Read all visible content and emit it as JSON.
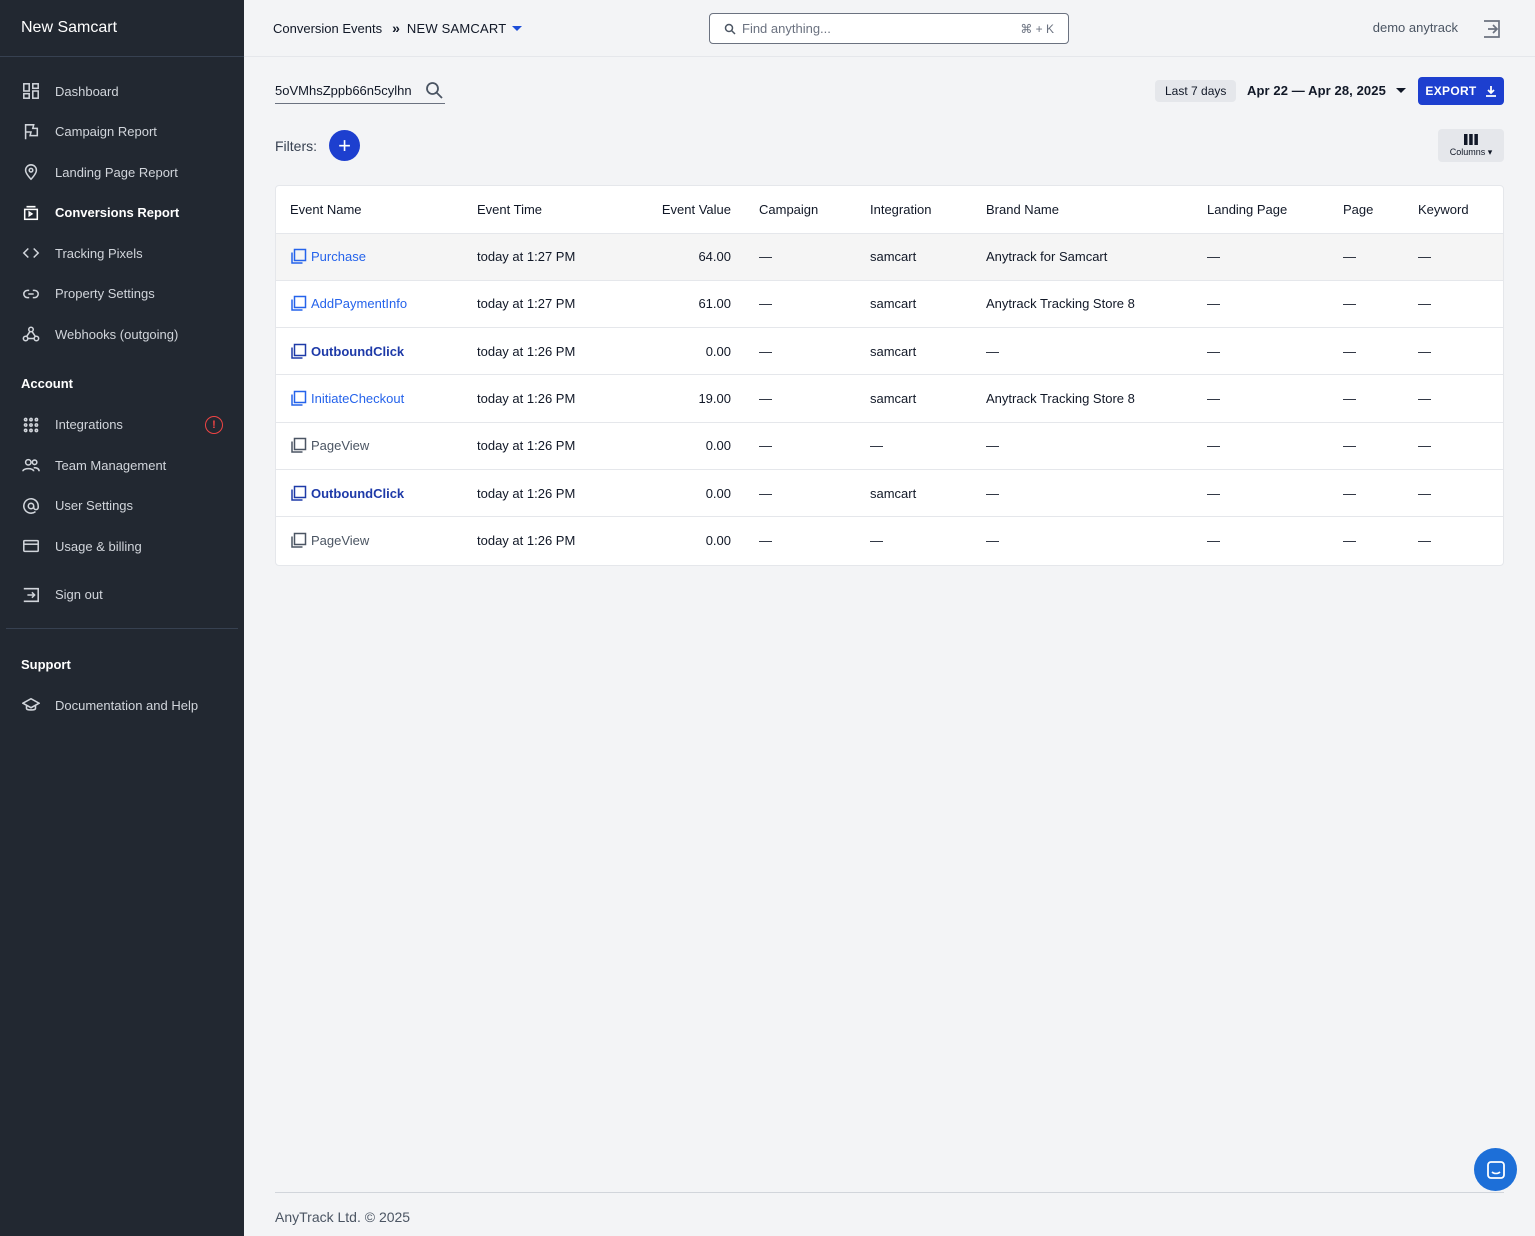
{
  "sidebar": {
    "brand": "New Samcart",
    "nav": [
      {
        "label": "Dashboard",
        "icon": "dashboard-icon"
      },
      {
        "label": "Campaign Report",
        "icon": "flag-icon"
      },
      {
        "label": "Landing Page Report",
        "icon": "map-pin-icon"
      },
      {
        "label": "Conversions Report",
        "icon": "inbox-icon",
        "active": true
      },
      {
        "label": "Tracking Pixels",
        "icon": "code-icon"
      },
      {
        "label": "Property Settings",
        "icon": "link-icon"
      },
      {
        "label": "Webhooks (outgoing)",
        "icon": "webhook-icon"
      }
    ],
    "account_title": "Account",
    "account": [
      {
        "label": "Integrations",
        "icon": "integrations-icon",
        "alert": "!"
      },
      {
        "label": "Team Management",
        "icon": "team-icon"
      },
      {
        "label": "User Settings",
        "icon": "at-sign-icon"
      },
      {
        "label": "Usage & billing",
        "icon": "credit-card-icon"
      }
    ],
    "signout": "Sign out",
    "support_title": "Support",
    "support": [
      {
        "label": "Documentation and Help",
        "icon": "graduation-cap-icon"
      }
    ]
  },
  "topbar": {
    "breadcrumb_root": "Conversion Events",
    "breadcrumb_sep": "»",
    "project": "NEW SAMCART",
    "search_placeholder": "Find anything...",
    "search_shortcut": "⌘ + K",
    "user": "demo anytrack"
  },
  "toolbar": {
    "id_search_value": "5oVMhsZppb66n5cylhn",
    "range_chip": "Last 7 days",
    "range_text": "Apr 22 — Apr 28, 2025",
    "export_label": "EXPORT",
    "filters_label": "Filters:",
    "add_filter": "+",
    "columns_label": "Columns ▾"
  },
  "table": {
    "headers": [
      "Event Name",
      "Event Time",
      "Event Value",
      "Campaign",
      "Integration",
      "Brand Name",
      "Landing Page",
      "Page",
      "Keyword"
    ],
    "rows": [
      {
        "event": "Purchase",
        "style": "c-light",
        "time": "today at 1:27 PM",
        "value": "64.00",
        "campaign": "—",
        "integration": "samcart",
        "brand": "Anytrack for Samcart",
        "landing": "—",
        "page": "—",
        "keyword": "—",
        "highlight": true
      },
      {
        "event": "AddPaymentInfo",
        "style": "c-light",
        "time": "today at 1:27 PM",
        "value": "61.00",
        "campaign": "—",
        "integration": "samcart",
        "brand": "Anytrack Tracking Store 8",
        "landing": "—",
        "page": "—",
        "keyword": "—"
      },
      {
        "event": "OutboundClick",
        "style": "c-dark",
        "time": "today at 1:26 PM",
        "value": "0.00",
        "campaign": "—",
        "integration": "samcart",
        "brand": "—",
        "landing": "—",
        "page": "—",
        "keyword": "—"
      },
      {
        "event": "InitiateCheckout",
        "style": "c-light",
        "time": "today at 1:26 PM",
        "value": "19.00",
        "campaign": "—",
        "integration": "samcart",
        "brand": "Anytrack Tracking Store 8",
        "landing": "—",
        "page": "—",
        "keyword": "—"
      },
      {
        "event": "PageView",
        "style": "c-gray",
        "time": "today at 1:26 PM",
        "value": "0.00",
        "campaign": "—",
        "integration": "—",
        "brand": "—",
        "landing": "—",
        "page": "—",
        "keyword": "—"
      },
      {
        "event": "OutboundClick",
        "style": "c-dark",
        "time": "today at 1:26 PM",
        "value": "0.00",
        "campaign": "—",
        "integration": "samcart",
        "brand": "—",
        "landing": "—",
        "page": "—",
        "keyword": "—"
      },
      {
        "event": "PageView",
        "style": "c-gray",
        "time": "today at 1:26 PM",
        "value": "0.00",
        "campaign": "—",
        "integration": "—",
        "brand": "—",
        "landing": "—",
        "page": "—",
        "keyword": "—"
      }
    ]
  },
  "footer": {
    "copyright": "AnyTrack Ltd. © 2025"
  },
  "colors": {
    "accent": "#1d3fcf",
    "sidebar_bg": "#222831",
    "alert": "#ef4444",
    "chat": "#1d6fd8"
  }
}
